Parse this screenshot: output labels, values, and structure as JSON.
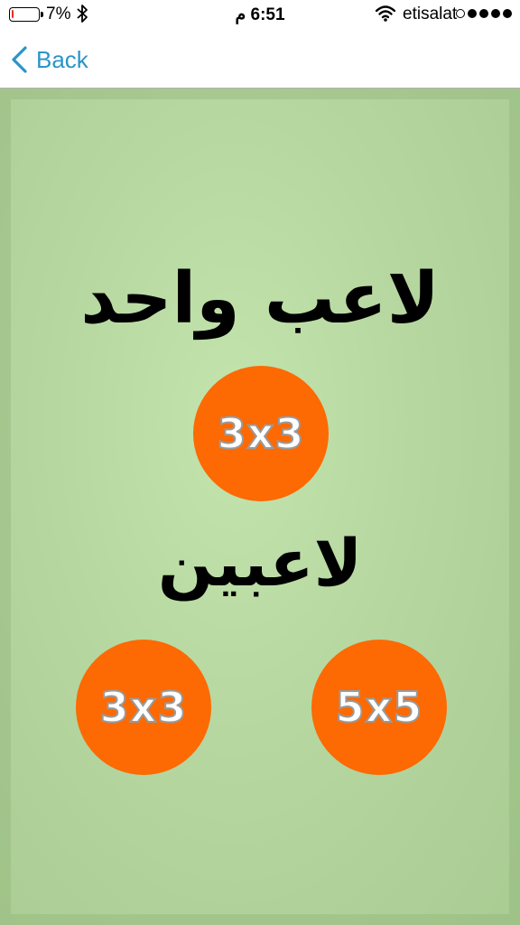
{
  "status_bar": {
    "battery_percent": "7%",
    "battery_level": 0.07,
    "battery_color": "#e52e24",
    "time": "6:51 م",
    "carrier": "etisalat",
    "signal_bars_filled": 4,
    "signal_bars_total": 5
  },
  "nav": {
    "back_label": "Back",
    "accent_color": "#2a95c8"
  },
  "content": {
    "single_player_heading": "لاعب واحد",
    "single_player_button": "3x3",
    "two_players_heading": "لاعبين",
    "two_players_button_small": "3x3",
    "two_players_button_large": "5x5",
    "button_color": "#fd6903"
  }
}
